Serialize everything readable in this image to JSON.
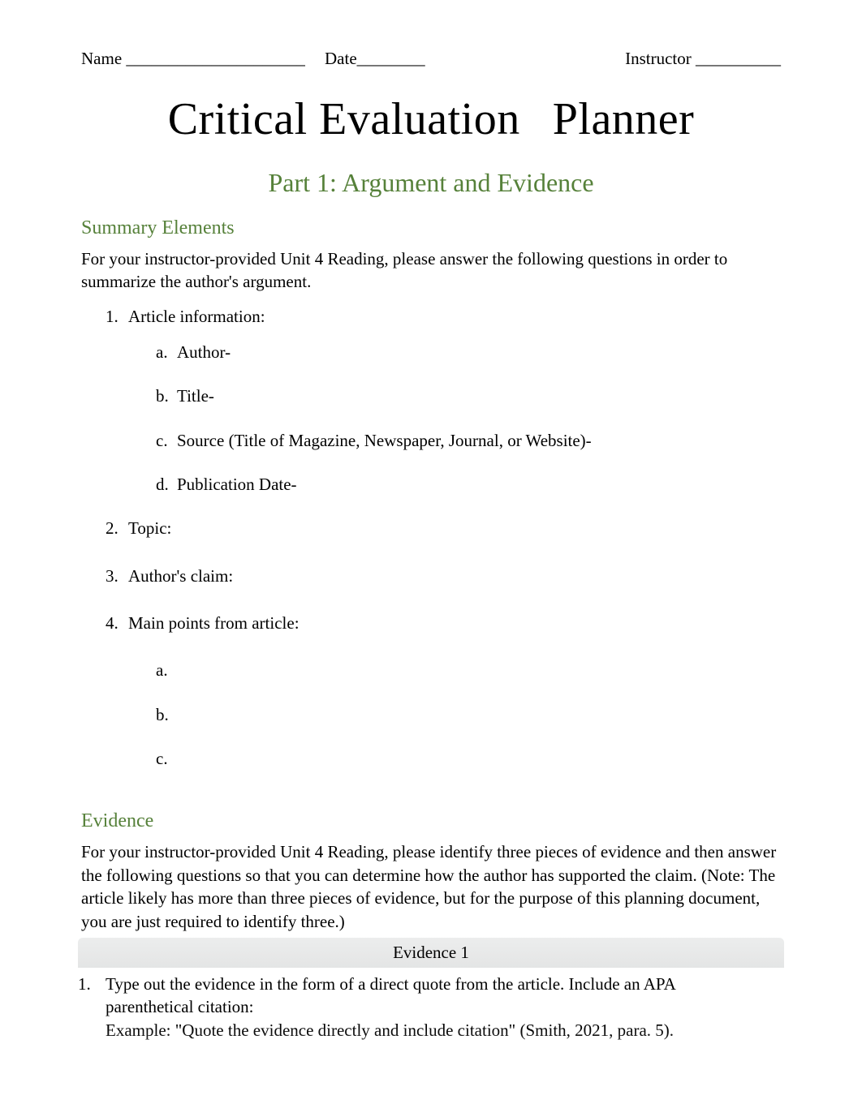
{
  "header": {
    "name_label": "Name",
    "name_line": "_____________________",
    "date_label": "Date",
    "date_line": "________",
    "instructor_label": "Instructor",
    "instructor_line": "__________"
  },
  "title": {
    "word1": "Critical Evaluation",
    "word2": "Planner"
  },
  "part_title": "Part 1: Argument and Evidence",
  "summary": {
    "heading": "Summary Elements",
    "intro": "For your instructor-provided Unit 4 Reading, please answer the following questions in order to summarize the author's argument.",
    "items": [
      {
        "num": "1.",
        "label": "Article information:",
        "sub": [
          {
            "letter": "a.",
            "text": "Author-"
          },
          {
            "letter": "b.",
            "text": "Title-"
          },
          {
            "letter": "c.",
            "text": "Source (Title of Magazine, Newspaper, Journal, or Website)-"
          },
          {
            "letter": "d.",
            "text": "Publication Date-"
          }
        ]
      },
      {
        "num": "2.",
        "label": "Topic:"
      },
      {
        "num": "3.",
        "label": "Author's claim:"
      },
      {
        "num": "4.",
        "label": "Main points from article:",
        "sub": [
          {
            "letter": "a.",
            "text": ""
          },
          {
            "letter": "b.",
            "text": ""
          },
          {
            "letter": "c.",
            "text": ""
          }
        ]
      }
    ]
  },
  "evidence": {
    "heading": "Evidence",
    "intro": "For your instructor-provided Unit 4 Reading, please identify three pieces of evidence and then answer the following questions so that you can determine how the author has supported the claim. (Note: The article likely has more than three pieces of evidence, but for the purpose of this planning document, you are just required to identify three.)",
    "block_title": "Evidence 1",
    "q_num": "1.",
    "q_text": "Type out the evidence in the form of a direct quote from the article. Include an APA parenthetical citation:",
    "example_label": "Example:",
    "example_text": " \"Quote the evidence directly and include citation\" (Smith, 2021, para. 5)."
  }
}
